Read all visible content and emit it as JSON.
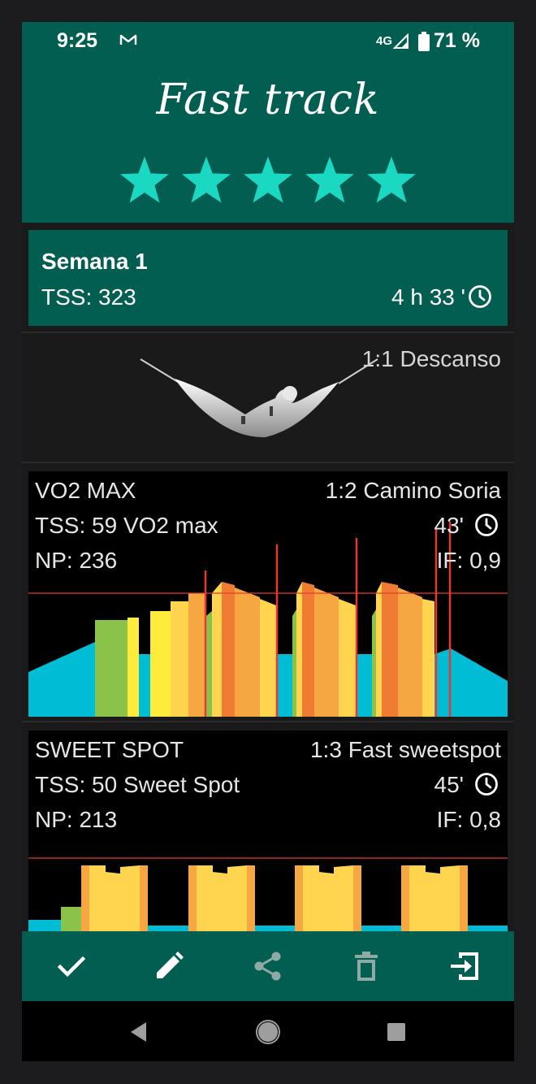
{
  "status_bar": {
    "time": "9:25",
    "network": "4G",
    "battery": "71 %"
  },
  "header": {
    "title": "Fast track",
    "rating": 5,
    "rating_max": 5,
    "star_color": "#1ad8c2",
    "bg_color": "#035e52"
  },
  "week": {
    "title": "Semana 1",
    "tss": "TSS: 323",
    "duration": "4 h 33 '"
  },
  "rest": {
    "label": "1:1 Descanso"
  },
  "workouts": [
    {
      "category": "VO2 MAX",
      "name": "1:2 Camino Soria",
      "tss": "TSS: 59 VO2 max",
      "duration": "43'",
      "np": "NP: 236",
      "if": "IF: 0,9"
    },
    {
      "category": "SWEET SPOT",
      "name": "1:3 Fast sweetspot",
      "tss": "TSS: 50 Sweet Spot",
      "duration": "45'",
      "np": "NP: 213",
      "if": "IF: 0,8"
    }
  ],
  "zone_colors": {
    "z1": "#00bcd4",
    "z2": "#8bc34a",
    "z3": "#ffeb3b",
    "z4": "#ffd54f",
    "z5": "#f7a741",
    "z6": "#f07b32",
    "ftp_line": "#e53935"
  },
  "bottom_actions": [
    "check-icon",
    "edit-icon",
    "share-icon",
    "delete-icon",
    "exit-icon"
  ]
}
